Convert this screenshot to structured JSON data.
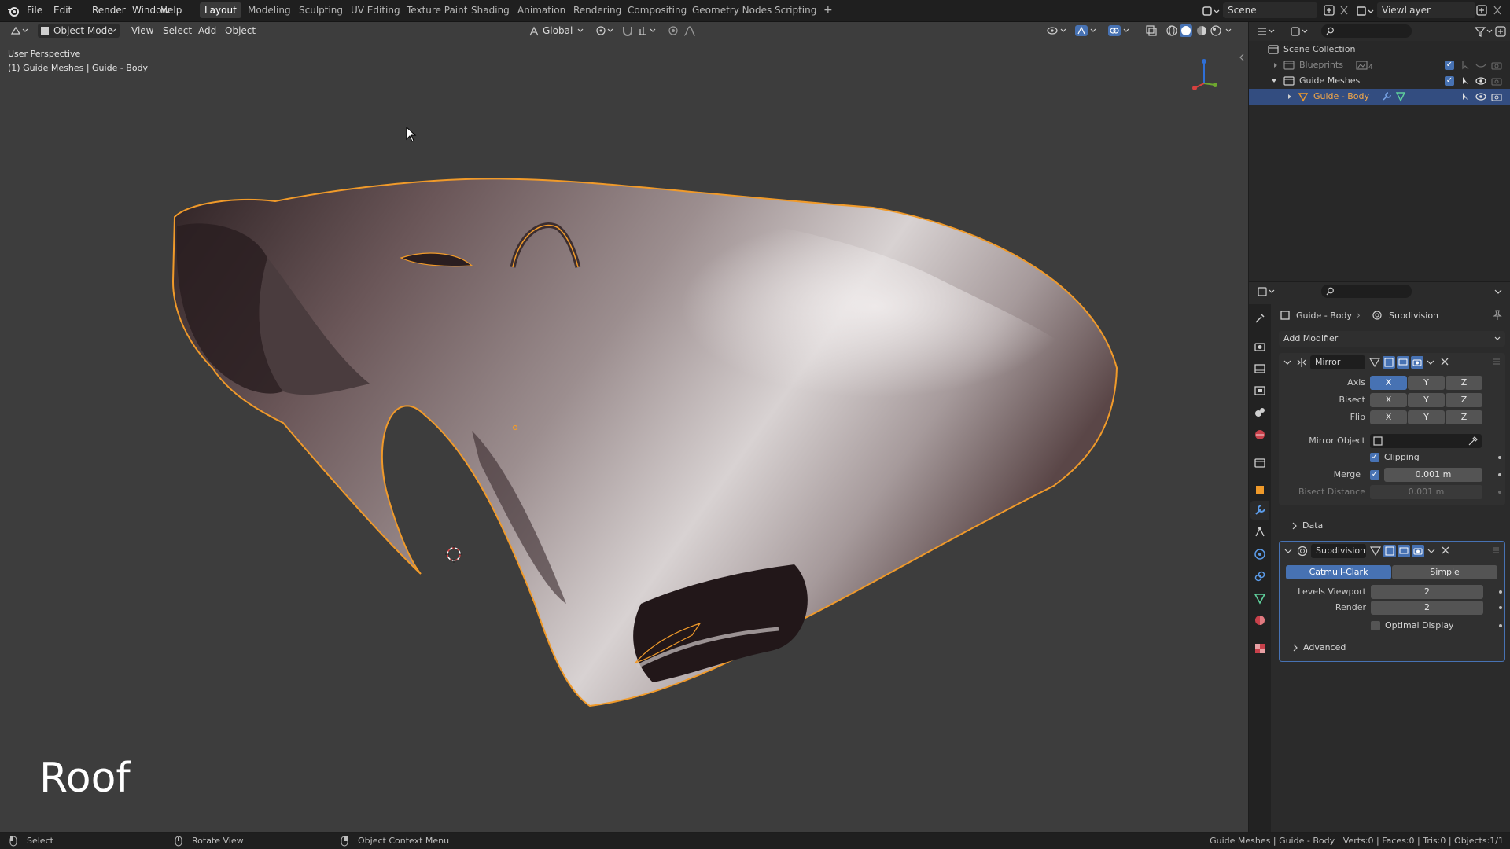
{
  "menubar": {
    "items": [
      "File",
      "Edit",
      "Render",
      "Window",
      "Help"
    ],
    "workspaces": [
      "Layout",
      "Modeling",
      "Sculpting",
      "UV Editing",
      "Texture Paint",
      "Shading",
      "Animation",
      "Rendering",
      "Compositing",
      "Geometry Nodes",
      "Scripting"
    ],
    "active_workspace": "Layout",
    "add_tab": "+",
    "scene": "Scene",
    "view_layer": "ViewLayer"
  },
  "viewport_header": {
    "mode": "Object Mode",
    "menus": [
      "View",
      "Select",
      "Add",
      "Object"
    ],
    "transform_orientation": "Global"
  },
  "viewport": {
    "perspective_label": "User Perspective",
    "object_label": "(1) Guide Meshes | Guide - Body",
    "overlay_caption": "Roof"
  },
  "outliner": {
    "root": "Scene Collection",
    "items": [
      {
        "label": "Blueprints",
        "count": "4"
      },
      {
        "label": "Guide Meshes"
      },
      {
        "label": "Guide - Body"
      }
    ]
  },
  "properties": {
    "breadcrumb_object": "Guide - Body",
    "breadcrumb_modifier": "Subdivision",
    "add_modifier": "Add Modifier",
    "mirror": {
      "name": "Mirror",
      "axis_label": "Axis",
      "bisect_label": "Bisect",
      "flip_label": "Flip",
      "x": "X",
      "y": "Y",
      "z": "Z",
      "mirror_object_label": "Mirror Object",
      "clipping_label": "Clipping",
      "merge_label": "Merge",
      "merge_value": "0.001 m",
      "bisect_distance_label": "Bisect Distance",
      "bisect_distance_value": "0.001 m",
      "data_label": "Data"
    },
    "subdivision": {
      "name": "Subdivision",
      "catmull": "Catmull-Clark",
      "simple": "Simple",
      "levels_viewport_label": "Levels Viewport",
      "levels_viewport_value": "2",
      "render_label": "Render",
      "render_value": "2",
      "optimal_display_label": "Optimal Display",
      "advanced_label": "Advanced"
    }
  },
  "statusbar": {
    "select": "Select",
    "rotate": "Rotate View",
    "context": "Object Context Menu",
    "stats": "Guide Meshes | Guide - Body | Verts:0 | Faces:0 | Tris:0 | Objects:1/1"
  },
  "colors": {
    "accent": "#4772b3",
    "selection_outline": "#f09a2a",
    "viewport_bg": "#3d3d3d"
  }
}
